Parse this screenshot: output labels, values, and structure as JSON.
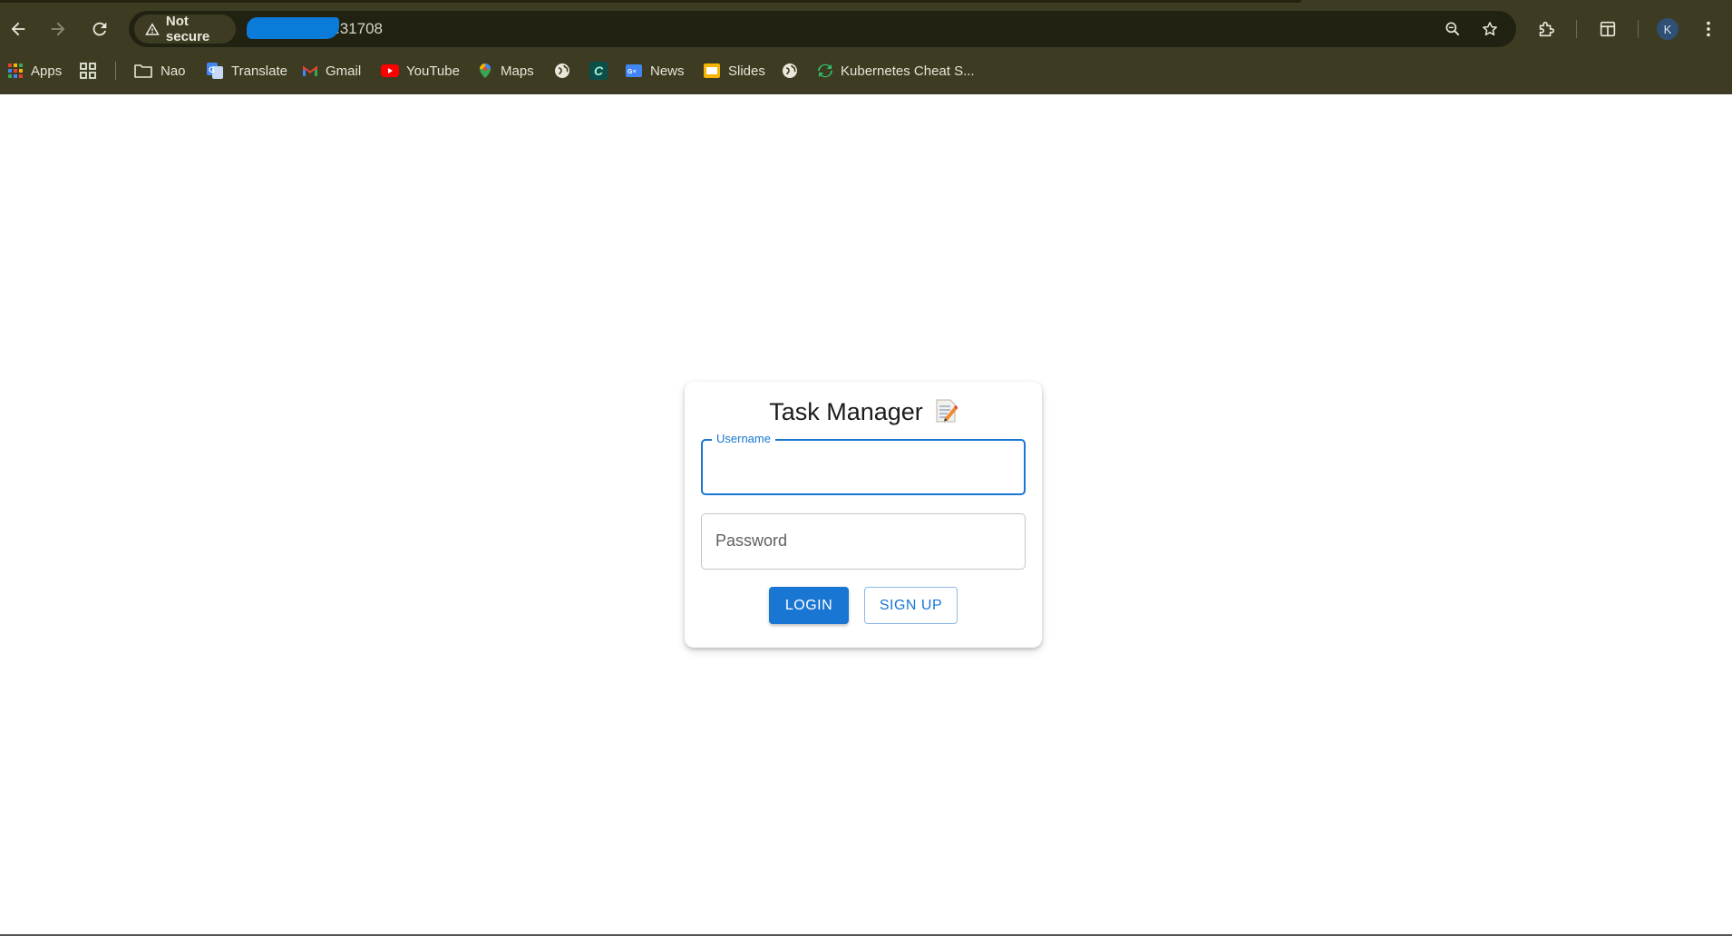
{
  "browser": {
    "security_label": "Not secure",
    "url_suffix": ":31708",
    "zoom_icon": "zoom-icon",
    "profile_initial": "K",
    "bookmarks": [
      {
        "label": "Apps",
        "icon": "apps-grid-icon"
      },
      {
        "label": "Nao",
        "icon": "folder-icon"
      },
      {
        "label": "Translate",
        "icon": "translate-icon"
      },
      {
        "label": "Gmail",
        "icon": "gmail-icon"
      },
      {
        "label": "YouTube",
        "icon": "youtube-icon"
      },
      {
        "label": "Maps",
        "icon": "maps-icon"
      },
      {
        "label": "News",
        "icon": "news-icon"
      },
      {
        "label": "Slides",
        "icon": "slides-icon"
      },
      {
        "label": "Kubernetes Cheat S...",
        "icon": "kubernetes-icon"
      }
    ]
  },
  "login": {
    "title": "Task Manager",
    "title_icon": "memo-icon",
    "username_label": "Username",
    "username_value": "",
    "password_label": "Password",
    "password_value": "",
    "login_button": "LOGIN",
    "signup_button": "SIGN UP"
  },
  "colors": {
    "chrome_bg": "#3d3c23",
    "omnibox_bg": "#222212",
    "accent": "#1976d2"
  }
}
